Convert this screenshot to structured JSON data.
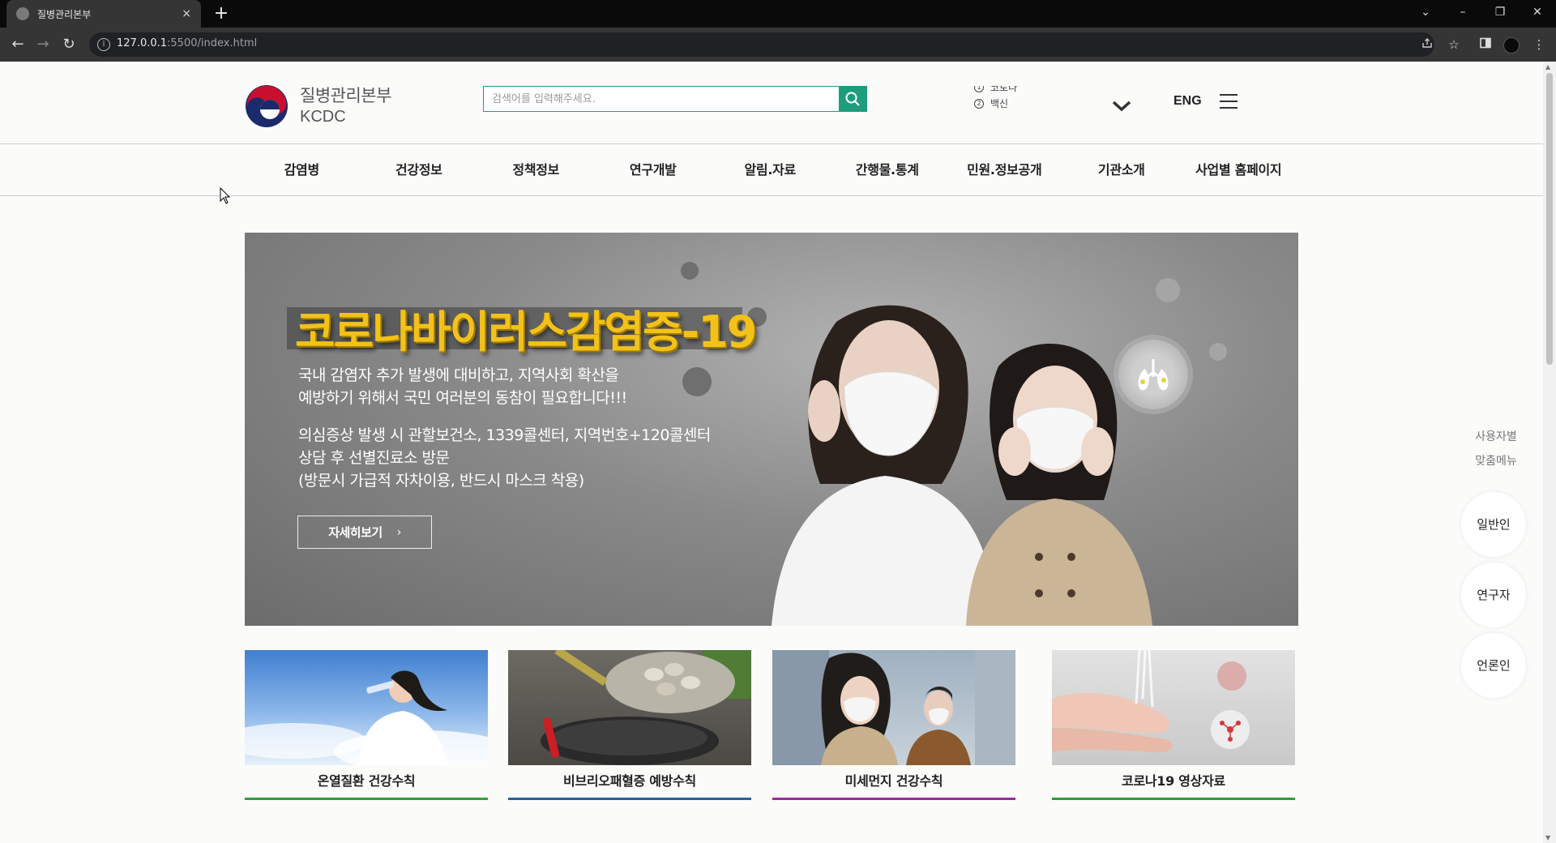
{
  "browser": {
    "tab_title": "질병관리본부",
    "tab_close": "×",
    "new_tab": "+",
    "url_host": "127.0.0.1",
    "url_rest": ":5500/index.html",
    "window_controls": [
      "⌄",
      "–",
      "❐",
      "✕"
    ],
    "nav": {
      "back": "←",
      "forward": "→",
      "reload": "↻"
    },
    "info_icon": "i"
  },
  "header": {
    "logo_ko": "질병관리본부",
    "logo_en": "KCDC",
    "search_placeholder": "검색어를 입력해주세요.",
    "ticker": [
      {
        "num": "1",
        "text": "코로나"
      },
      {
        "num": "2",
        "text": "백신"
      }
    ],
    "eng_label": "ENG"
  },
  "gnb": [
    "감염병",
    "건강정보",
    "정책정보",
    "연구개발",
    "알림.자료",
    "간행물.통계",
    "민원.정보공개",
    "기관소개",
    "사업별 홈페이지"
  ],
  "hero": {
    "headline": "코로나바이러스감염증-19",
    "para1_line1": "국내 감염자 추가 발생에 대비하고, 지역사회 확산을",
    "para1_line2": "예방하기 위해서 국민 여러분의 동참이 필요합니다!!!",
    "para2_line1": "의심증상 발생 시 관할보건소, 1339콜센터, 지역번호+120콜센터",
    "para2_line2": "상담 후 선별진료소 방문",
    "para2_line3": "(방문시 가급적 자차이용, 반드시 마스크 착용)",
    "more_label": "자세히보기",
    "more_arrow": "›"
  },
  "side_menu": {
    "title_line1": "사용자별",
    "title_line2": "맞춤메뉴",
    "items": [
      "일반인",
      "연구자",
      "언론인"
    ]
  },
  "cards": [
    {
      "label": "온열질환 건강수칙",
      "accent": "#2e9e3c"
    },
    {
      "label": "비브리오패혈증 예방수칙",
      "accent": "#2a5f9e"
    },
    {
      "label": "미세먼지 건강수칙",
      "accent": "#9b2b9b"
    },
    {
      "label": "코로나19 영상자료",
      "accent": "#2e9e3c"
    }
  ],
  "colors": {
    "brand_green": "#1e9d7d",
    "headline_yellow": "#f2c21a"
  }
}
